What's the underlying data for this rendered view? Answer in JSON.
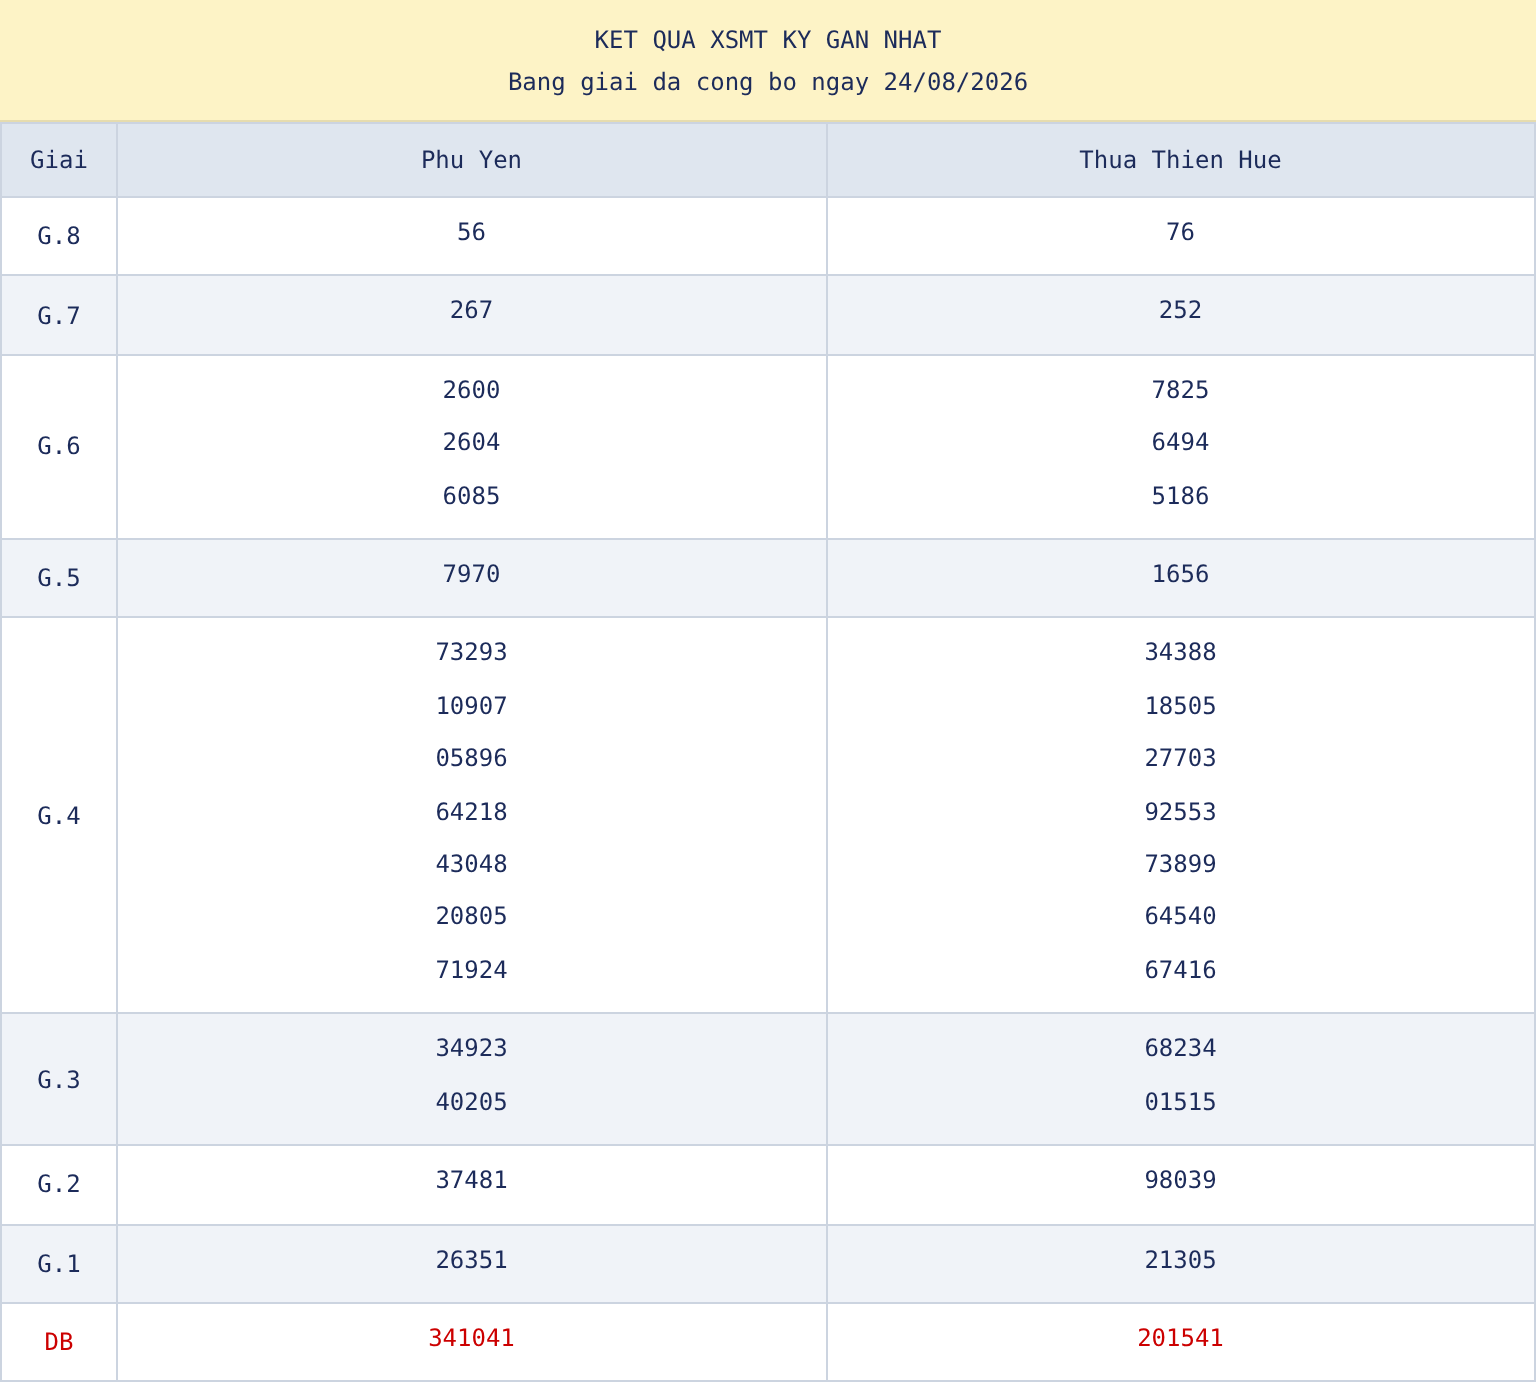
{
  "header": {
    "title": "KET QUA XSMT KY GAN NHAT",
    "subtitle": "Bang giai da cong bo ngay 24/08/2026"
  },
  "table": {
    "columns": [
      "Giai",
      "Phu Yen",
      "Thua Thien Hue"
    ],
    "rows": [
      {
        "kind": "regular",
        "cells": [
          [
            "G.8"
          ],
          [
            "56"
          ],
          [
            "76"
          ]
        ]
      },
      {
        "kind": "regular",
        "cells": [
          [
            "G.7"
          ],
          [
            "267"
          ],
          [
            "252"
          ]
        ]
      },
      {
        "kind": "regular",
        "cells": [
          [
            "G.6"
          ],
          [
            "2600",
            "2604",
            "6085"
          ],
          [
            "7825",
            "6494",
            "5186"
          ]
        ]
      },
      {
        "kind": "regular",
        "cells": [
          [
            "G.5"
          ],
          [
            "7970"
          ],
          [
            "1656"
          ]
        ]
      },
      {
        "kind": "regular",
        "cells": [
          [
            "G.4"
          ],
          [
            "73293",
            "10907",
            "05896",
            "64218",
            "43048",
            "20805",
            "71924"
          ],
          [
            "34388",
            "18505",
            "27703",
            "92553",
            "73899",
            "64540",
            "67416"
          ]
        ]
      },
      {
        "kind": "regular",
        "cells": [
          [
            "G.3"
          ],
          [
            "34923",
            "40205"
          ],
          [
            "68234",
            "01515"
          ]
        ]
      },
      {
        "kind": "regular",
        "cells": [
          [
            "G.2"
          ],
          [
            "37481"
          ],
          [
            "98039"
          ]
        ]
      },
      {
        "kind": "regular",
        "cells": [
          [
            "G.1"
          ],
          [
            "26351"
          ],
          [
            "21305"
          ]
        ]
      },
      {
        "kind": "special",
        "cells": [
          [
            "DB"
          ],
          [
            "341041"
          ],
          [
            "201541"
          ]
        ]
      }
    ]
  }
}
